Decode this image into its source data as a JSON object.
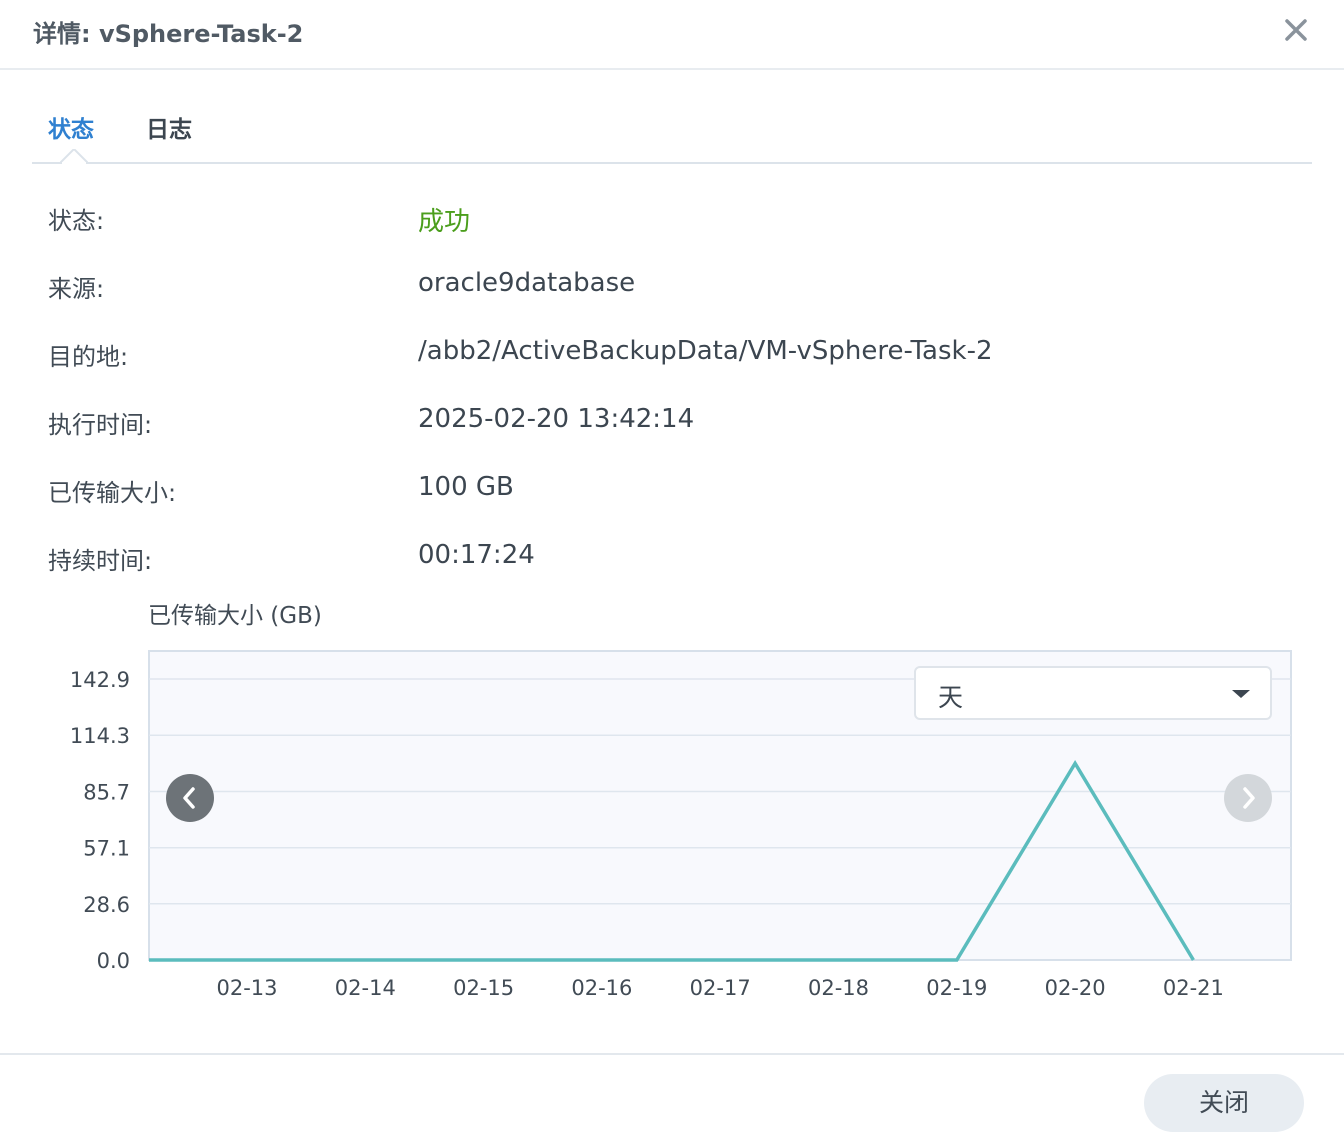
{
  "dialog": {
    "title": "详情: vSphere-Task-2"
  },
  "tabs": [
    {
      "label": "状态",
      "active": true
    },
    {
      "label": "日志",
      "active": false
    }
  ],
  "details": [
    {
      "label": "状态:",
      "value": "成功"
    },
    {
      "label": "来源:",
      "value": "oracle9database"
    },
    {
      "label": "目的地:",
      "value": "/abb2/ActiveBackupData/VM-vSphere-Task-2"
    },
    {
      "label": "执行时间:",
      "value": "2025-02-20 13:42:14"
    },
    {
      "label": "已传输大小:",
      "value": "100 GB"
    },
    {
      "label": "持续时间:",
      "value": "00:17:24"
    }
  ],
  "range_select": {
    "value": "天"
  },
  "footer": {
    "close_label": "关闭"
  },
  "colors": {
    "accent": "#2f80d0",
    "success": "#4b9e1c",
    "series": "#5bbcbd",
    "plot_bg": "#f8f9fd"
  },
  "chart_data": {
    "type": "line",
    "title": "已传输大小 (GB)",
    "xlabel": "",
    "ylabel": "",
    "x": [
      "02-13",
      "02-14",
      "02-15",
      "02-16",
      "02-17",
      "02-18",
      "02-19",
      "02-20",
      "02-21"
    ],
    "y_ticks": [
      "0.0",
      "28.6",
      "57.1",
      "85.7",
      "114.3",
      "142.9"
    ],
    "ylim": [
      0,
      142.9
    ],
    "grid": true,
    "series": [
      {
        "values": [
          0,
          0,
          0,
          0,
          0,
          0,
          0,
          100,
          0
        ]
      }
    ]
  }
}
